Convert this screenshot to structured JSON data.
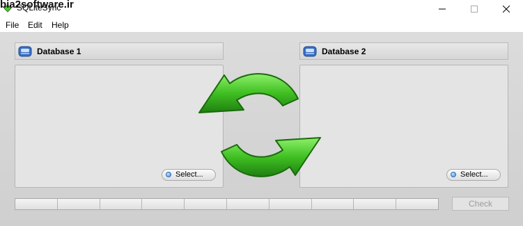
{
  "window": {
    "watermark": "bia2software.ir",
    "title": "SQLiteSync",
    "controls": {
      "minimize_icon": "minimize-icon",
      "maximize_icon": "maximize-icon",
      "close_icon": "close-icon"
    }
  },
  "menu": {
    "items": [
      {
        "label": "File"
      },
      {
        "label": "Edit"
      },
      {
        "label": "Help"
      }
    ]
  },
  "database1": {
    "title": "Database 1",
    "select_label": "Select..."
  },
  "database2": {
    "title": "Database 2",
    "select_label": "Select..."
  },
  "progress": {
    "value": 0,
    "segments": 10
  },
  "check_button": {
    "label": "Check",
    "enabled": false
  },
  "colors": {
    "arrow_green": "#3fbf22",
    "database_icon_blue": "#3a6fc4"
  }
}
